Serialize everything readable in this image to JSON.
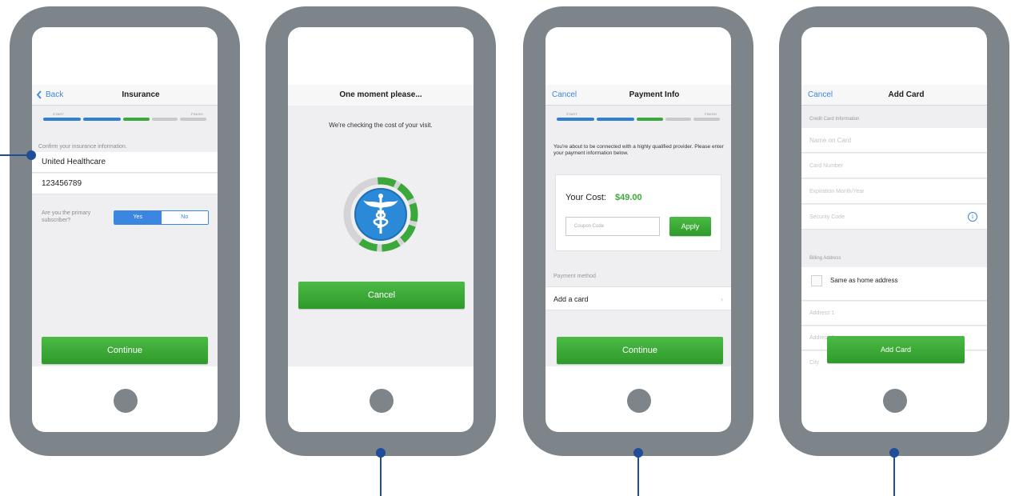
{
  "screens": {
    "insurance": {
      "back_label": "Back",
      "title": "Insurance",
      "progress_start": "START",
      "progress_finish": "FINISH",
      "confirm_text": "Confirm your insurance information.",
      "provider_value": "United Healthcare",
      "member_id_value": "123456789",
      "subscriber_question": "Are you the primary subscriber?",
      "yes_label": "Yes",
      "no_label": "No",
      "continue_label": "Continue"
    },
    "loading": {
      "title": "One moment please...",
      "message": "We're checking the cost of your visit.",
      "cancel_label": "Cancel"
    },
    "payment": {
      "cancel_label": "Cancel",
      "title": "Payment Info",
      "progress_start": "START",
      "progress_finish": "FINISH",
      "intro_text": "You're about to be connected with a highly qualified provider. Please enter your payment information below.",
      "cost_label": "Your Cost:",
      "cost_value": "$49.00",
      "coupon_placeholder": "Coupon Code",
      "apply_label": "Apply",
      "payment_method_header": "Payment method",
      "add_card_label": "Add a card",
      "continue_label": "Continue"
    },
    "add_card": {
      "cancel_label": "Cancel",
      "title": "Add Card",
      "credit_card_header": "Credit Card Information",
      "name_placeholder": "Name on Card",
      "number_placeholder": "Card Number",
      "expiration_placeholder": "Expiration Month/Year",
      "security_placeholder": "Security Code",
      "billing_header": "Billing Address",
      "same_as_home_label": "Same as home address",
      "address1_placeholder": "Address 1",
      "address2_placeholder": "Address 2",
      "city_placeholder": "City",
      "add_card_button": "Add Card"
    }
  },
  "colors": {
    "frame": "#7d858a",
    "accent_blue": "#3b86e0",
    "progress_blue": "#2f7fd6",
    "progress_green": "#3aa83a",
    "button_green": "#3aa83a",
    "annotation": "#1f4d99"
  },
  "progress_fraction": 0.6
}
